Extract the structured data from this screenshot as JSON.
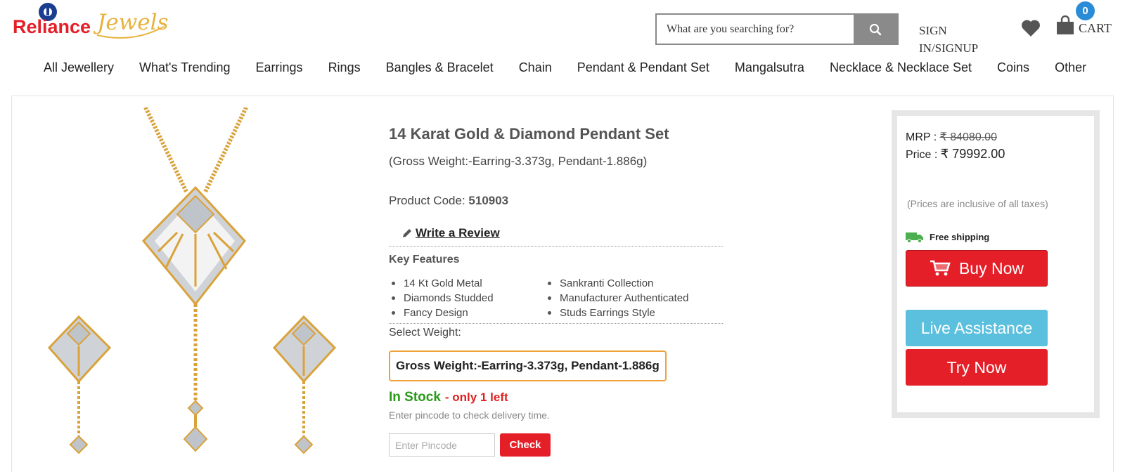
{
  "header": {
    "logo_text": "Reliance Jewels",
    "search_placeholder": "What are you searching for?",
    "signin_line1": "SIGN",
    "signin_line2": "IN/SIGNUP",
    "cart_label": "CART",
    "cart_count": "0"
  },
  "nav": [
    "All Jewellery",
    "What's Trending",
    "Earrings",
    "Rings",
    "Bangles & Bracelet",
    "Chain",
    "Pendant & Pendant Set",
    "Mangalsutra",
    "Necklace & Necklace Set",
    "Coins",
    "Other"
  ],
  "product": {
    "title": "14 Karat Gold & Diamond Pendant Set",
    "subtitle": "(Gross Weight:-Earring-3.373g, Pendant-1.886g)",
    "code_label": "Product Code: ",
    "code_value": "510903",
    "review_label": "Write a Review",
    "key_features_title": "Key Features",
    "features": [
      "14 Kt Gold Metal",
      "Sankranti Collection",
      "Diamonds Studded",
      "Manufacturer Authenticated",
      "Fancy Design",
      "Studs Earrings Style"
    ],
    "select_weight_label": "Select Weight:",
    "weight_option": "Gross Weight:-Earring-3.373g, Pendant-1.886g",
    "stock_status": "In Stock",
    "stock_left": "- only 1 left",
    "delivery_hint": "Enter pincode to check delivery time.",
    "pincode_placeholder": "Enter Pincode",
    "check_label": "Check"
  },
  "pricing": {
    "mrp_label": "MRP : ",
    "mrp_value": "₹ 84080.00",
    "price_label": "Price : ",
    "price_value": "₹ 79992.00",
    "tax_note": "(Prices are inclusive of all taxes)",
    "shipping_label": "Free shipping",
    "buy_label": "Buy Now",
    "live_label": "Live Assistance",
    "try_label": "Try Now"
  },
  "colors": {
    "brand_blue": "#1a3d8f",
    "brand_red": "#e51f28",
    "gold": "#e8b23c",
    "live_blue": "#5bc0de",
    "stock_green": "#2a9a1a",
    "ship_green": "#4caf50"
  }
}
